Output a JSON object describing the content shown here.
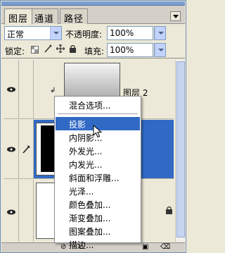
{
  "tabs": [
    {
      "label": "图层",
      "active": true
    },
    {
      "label": "通道",
      "active": false
    },
    {
      "label": "路径",
      "active": false
    }
  ],
  "blend_mode": {
    "value": "正常"
  },
  "opacity": {
    "label": "不透明度:",
    "value": "100%"
  },
  "lock": {
    "label": "锁定:"
  },
  "fill": {
    "label": "填充:",
    "value": "100%"
  },
  "layers": [
    {
      "name": "图层 2",
      "visible": true,
      "selected": false
    },
    {
      "name": "",
      "visible": true,
      "selected": true
    },
    {
      "name": "",
      "visible": true,
      "selected": false,
      "locked": true
    }
  ],
  "context_menu": {
    "items": [
      {
        "label": "混合选项...",
        "highlighted": false
      },
      {
        "label": "投影",
        "highlighted": true
      },
      {
        "label": "内阴影...",
        "highlighted": false
      },
      {
        "label": "外发光...",
        "highlighted": false
      },
      {
        "label": "内发光...",
        "highlighted": false
      },
      {
        "label": "斜面和浮雕...",
        "highlighted": false
      },
      {
        "label": "光泽...",
        "highlighted": false
      },
      {
        "label": "颜色叠加...",
        "highlighted": false
      },
      {
        "label": "渐变叠加...",
        "highlighted": false
      },
      {
        "label": "图案叠加...",
        "highlighted": false
      },
      {
        "label": "描边...",
        "highlighted": false
      }
    ]
  },
  "colors": {
    "selection": "#316ac5",
    "panel_bg": "#ece9d8"
  }
}
